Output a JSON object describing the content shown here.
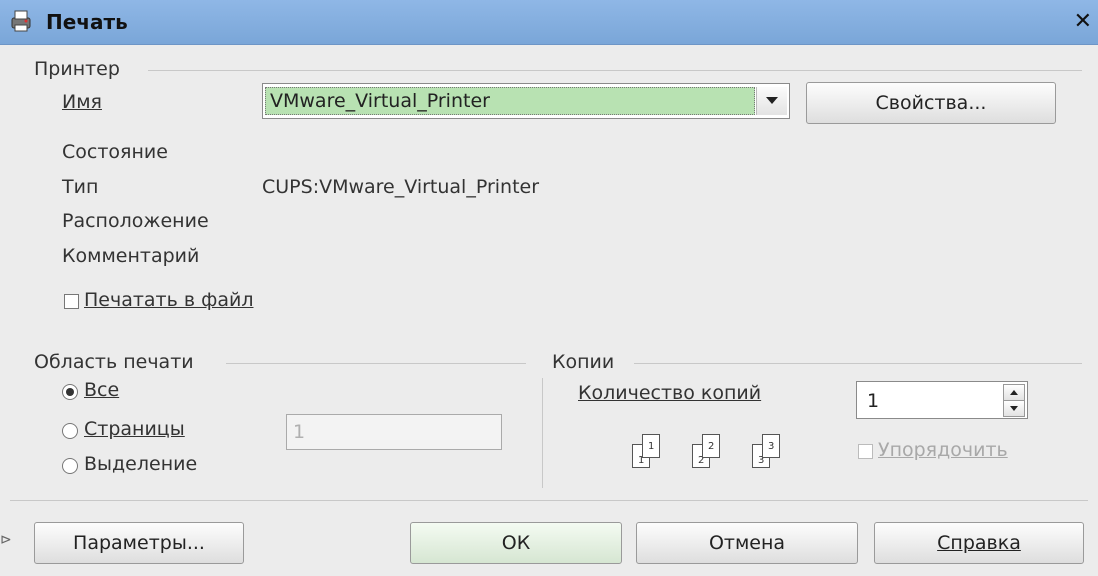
{
  "window": {
    "title": "Печать",
    "close_icon": "close-icon"
  },
  "printer": {
    "group_label": "Принтер",
    "name_label": "Имя",
    "name_value": "VMware_Virtual_Printer",
    "properties_button": "Свойства...",
    "status_label": "Состояние",
    "status_value": "",
    "type_label": "Тип",
    "type_value": "CUPS:VMware_Virtual_Printer",
    "location_label": "Расположение",
    "comment_label": "Комментарий",
    "print_to_file": {
      "label": "Печатать в файл",
      "checked": false
    }
  },
  "print_range": {
    "group_label": "Область печати",
    "options": [
      {
        "label": "Все",
        "selected": true
      },
      {
        "label": "Страницы",
        "selected": false
      },
      {
        "label": "Выделение",
        "selected": false
      }
    ],
    "pages_value": "1"
  },
  "copies": {
    "group_label": "Копии",
    "count_label": "Количество копий",
    "count_value": "1",
    "collate": {
      "label": "Упорядочить",
      "checked": false,
      "enabled": false
    },
    "collate_icon_numbers": [
      "1",
      "2",
      "3"
    ]
  },
  "buttons": {
    "options": "Параметры...",
    "ok": "ОК",
    "cancel": "Отмена",
    "help": "Справка"
  }
}
